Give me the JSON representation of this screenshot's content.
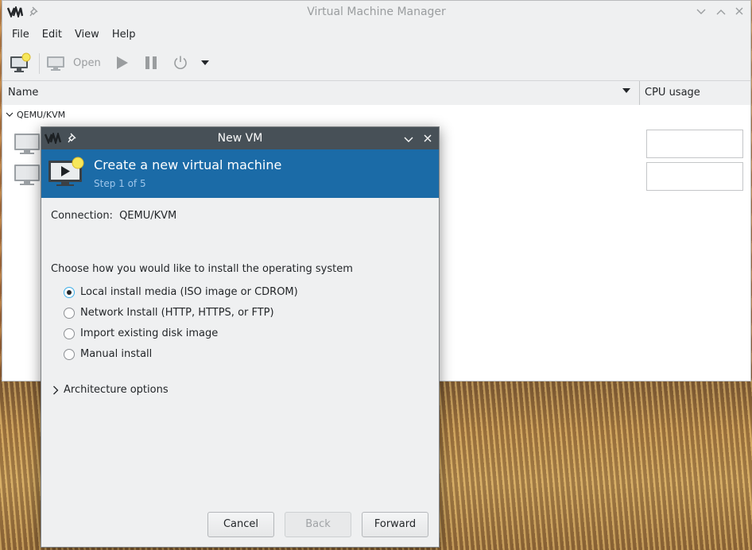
{
  "main_window": {
    "title": "Virtual Machine Manager",
    "menu": [
      "File",
      "Edit",
      "View",
      "Help"
    ],
    "toolbar": {
      "open_label": "Open"
    },
    "columns": {
      "name": "Name",
      "cpu": "CPU usage"
    },
    "group": "QEMU/KVM"
  },
  "dialog": {
    "title": "New VM",
    "banner_title": "Create a new virtual machine",
    "banner_step": "Step 1 of 5",
    "connection_label": "Connection:",
    "connection_value": "QEMU/KVM",
    "prompt": "Choose how you would like to install the operating system",
    "options": [
      {
        "label": "Local install media (ISO image or CDROM)",
        "selected": true
      },
      {
        "label": "Network Install (HTTP, HTTPS, or FTP)",
        "selected": false
      },
      {
        "label": "Import existing disk image",
        "selected": false
      },
      {
        "label": "Manual install",
        "selected": false
      }
    ],
    "architecture": "Architecture options",
    "buttons": {
      "cancel": "Cancel",
      "back": "Back",
      "forward": "Forward"
    }
  },
  "icons": [
    "vm-logo-icon",
    "pin-icon",
    "chevron-down-icon",
    "chevron-up-icon",
    "close-icon",
    "new-vm-icon",
    "monitor-icon",
    "play-icon",
    "pause-icon",
    "power-icon",
    "dropdown-arrow-icon",
    "expander-icon"
  ],
  "colors": {
    "banner": "#1b6ba7",
    "dialog_titlebar": "#475057",
    "radio_focus": "#3daee9"
  }
}
